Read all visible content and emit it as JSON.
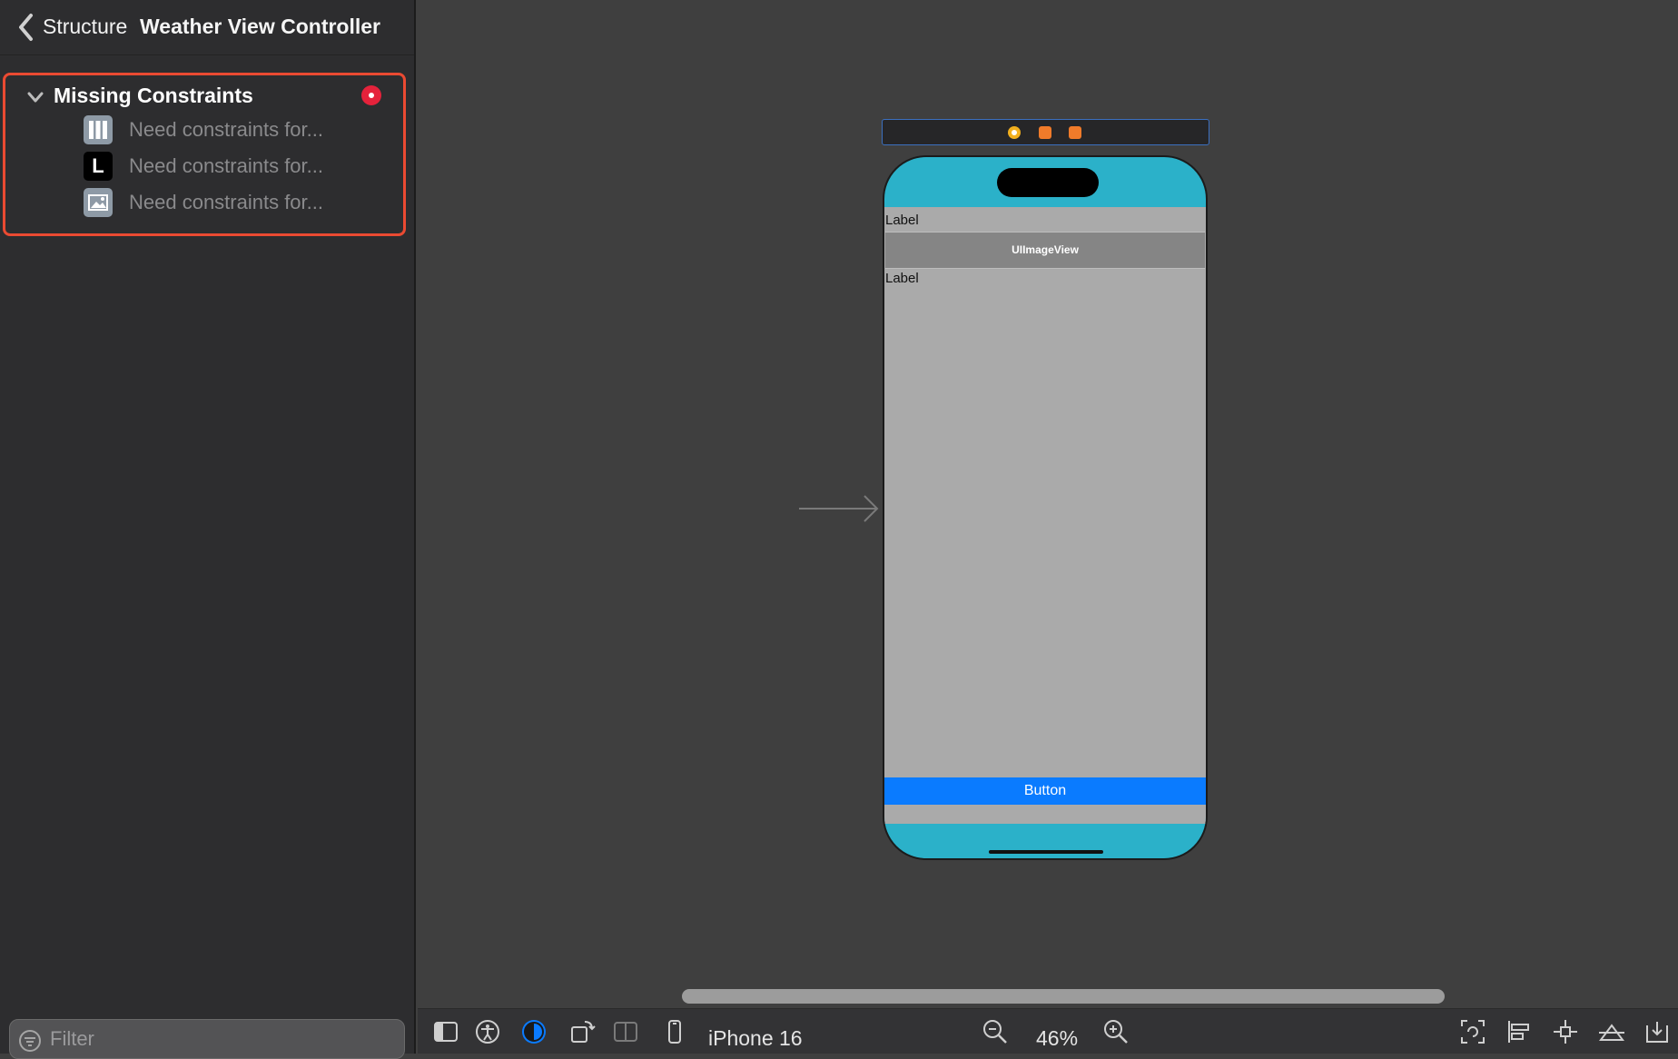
{
  "sidebar": {
    "breadcrumb_parent": "Structure",
    "title": "Weather View Controller",
    "issue_group": {
      "title": "Missing Constraints",
      "items": [
        {
          "icon": "stack-view-icon",
          "text": "Need constraints for..."
        },
        {
          "icon": "label-icon",
          "icon_letter": "L",
          "text": "Need constraints for..."
        },
        {
          "icon": "image-view-icon",
          "text": "Need constraints for..."
        }
      ]
    },
    "filter": {
      "placeholder": "Filter"
    }
  },
  "canvas": {
    "scene": {
      "label_top": "Label",
      "image_view": "UIImageView",
      "label_bottom": "Label",
      "button": "Button"
    }
  },
  "toolbar": {
    "device": "iPhone 16",
    "zoom": "46%"
  },
  "colors": {
    "accent": "#0a7bff",
    "issue_border": "#ea4a32",
    "error_badge": "#e5223b",
    "scene_background": "#2bb1c9"
  }
}
